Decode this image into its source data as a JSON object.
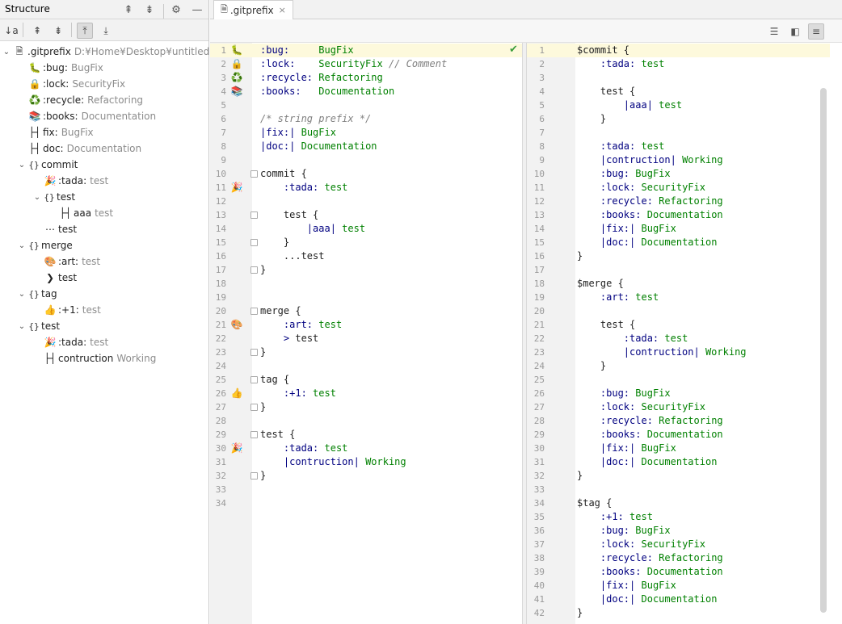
{
  "structure": {
    "title": "Structure",
    "root": {
      "name": ".gitprefix",
      "path": "D:¥Home¥Desktop¥untitled"
    },
    "nodes": [
      {
        "indent": 1,
        "icon": "🐛",
        "name": ":bug:",
        "value": "BugFix"
      },
      {
        "indent": 1,
        "icon": "🔒",
        "name": ":lock:",
        "value": "SecurityFix"
      },
      {
        "indent": 1,
        "icon": "♻️",
        "name": ":recycle:",
        "value": "Refactoring"
      },
      {
        "indent": 1,
        "icon": "📚",
        "name": ":books:",
        "value": "Documentation"
      },
      {
        "indent": 1,
        "icon": "├┤",
        "name": "fix:",
        "value": "BugFix"
      },
      {
        "indent": 1,
        "icon": "├┤",
        "name": "doc:",
        "value": "Documentation"
      },
      {
        "indent": 1,
        "icon": "{}",
        "name": "commit",
        "value": "",
        "arrow": "⌄"
      },
      {
        "indent": 2,
        "icon": "🎉",
        "name": ":tada:",
        "value": "test"
      },
      {
        "indent": 2,
        "icon": "{}",
        "name": "test",
        "value": "",
        "arrow": "⌄"
      },
      {
        "indent": 3,
        "icon": "├┤",
        "name": "aaa",
        "value": "test"
      },
      {
        "indent": 2,
        "icon": "⋯",
        "name": "test",
        "value": ""
      },
      {
        "indent": 1,
        "icon": "{}",
        "name": "merge",
        "value": "",
        "arrow": "⌄"
      },
      {
        "indent": 2,
        "icon": "🎨",
        "name": ":art:",
        "value": "test"
      },
      {
        "indent": 2,
        "icon": "❯",
        "name": "test",
        "value": ""
      },
      {
        "indent": 1,
        "icon": "{}",
        "name": "tag",
        "value": "",
        "arrow": "⌄"
      },
      {
        "indent": 2,
        "icon": "👍",
        "name": ":+1:",
        "value": "test"
      },
      {
        "indent": 1,
        "icon": "{}",
        "name": "test",
        "value": "",
        "arrow": "⌄"
      },
      {
        "indent": 2,
        "icon": "🎉",
        "name": ":tada:",
        "value": "test"
      },
      {
        "indent": 2,
        "icon": "├┤",
        "name": "contruction",
        "value": "Working"
      }
    ]
  },
  "editor": {
    "tab_label": ".gitprefix",
    "tab_close": "×"
  },
  "left_pane": {
    "lines": [
      {
        "n": "1",
        "icon": "🐛",
        "parts": [
          [
            "k",
            ":bug:     "
          ],
          [
            "s",
            "BugFix"
          ]
        ]
      },
      {
        "n": "2",
        "icon": "🔒",
        "parts": [
          [
            "k",
            ":lock:    "
          ],
          [
            "s",
            "SecurityFix"
          ],
          [
            "c",
            " // Comment"
          ]
        ]
      },
      {
        "n": "3",
        "icon": "♻️",
        "parts": [
          [
            "k",
            ":recycle: "
          ],
          [
            "s",
            "Refactoring"
          ]
        ]
      },
      {
        "n": "4",
        "icon": "📚",
        "parts": [
          [
            "k",
            ":books:   "
          ],
          [
            "s",
            "Documentation"
          ]
        ]
      },
      {
        "n": "5",
        "icon": "",
        "parts": []
      },
      {
        "n": "6",
        "icon": "",
        "parts": [
          [
            "c",
            "/* string prefix */"
          ]
        ]
      },
      {
        "n": "7",
        "icon": "",
        "parts": [
          [
            "k",
            "|fix:|"
          ],
          [
            "p",
            " "
          ],
          [
            "s",
            "BugFix"
          ]
        ]
      },
      {
        "n": "8",
        "icon": "",
        "parts": [
          [
            "k",
            "|doc:|"
          ],
          [
            "p",
            " "
          ],
          [
            "s",
            "Documentation"
          ]
        ]
      },
      {
        "n": "9",
        "icon": "",
        "parts": []
      },
      {
        "n": "10",
        "icon": "",
        "parts": [
          [
            "p",
            "commit {"
          ]
        ]
      },
      {
        "n": "11",
        "icon": "🎉",
        "parts": [
          [
            "p",
            "    "
          ],
          [
            "k",
            ":tada:"
          ],
          [
            "p",
            " "
          ],
          [
            "s",
            "test"
          ]
        ]
      },
      {
        "n": "12",
        "icon": "",
        "parts": []
      },
      {
        "n": "13",
        "icon": "",
        "parts": [
          [
            "p",
            "    test {"
          ]
        ]
      },
      {
        "n": "14",
        "icon": "",
        "parts": [
          [
            "p",
            "        "
          ],
          [
            "k",
            "|aaa|"
          ],
          [
            "p",
            " "
          ],
          [
            "s",
            "test"
          ]
        ]
      },
      {
        "n": "15",
        "icon": "",
        "parts": [
          [
            "p",
            "    }"
          ]
        ]
      },
      {
        "n": "16",
        "icon": "",
        "parts": [
          [
            "p",
            "    ...test"
          ]
        ]
      },
      {
        "n": "17",
        "icon": "",
        "parts": [
          [
            "p",
            "}"
          ]
        ]
      },
      {
        "n": "18",
        "icon": "",
        "parts": []
      },
      {
        "n": "19",
        "icon": "",
        "parts": []
      },
      {
        "n": "20",
        "icon": "",
        "parts": [
          [
            "p",
            "merge {"
          ]
        ]
      },
      {
        "n": "21",
        "icon": "🎨",
        "parts": [
          [
            "p",
            "    "
          ],
          [
            "k",
            ":art:"
          ],
          [
            "p",
            " "
          ],
          [
            "s",
            "test"
          ]
        ]
      },
      {
        "n": "22",
        "icon": "",
        "parts": [
          [
            "p",
            "    "
          ],
          [
            "k",
            ">"
          ],
          [
            "p",
            " test"
          ]
        ]
      },
      {
        "n": "23",
        "icon": "",
        "parts": [
          [
            "p",
            "}"
          ]
        ]
      },
      {
        "n": "24",
        "icon": "",
        "parts": []
      },
      {
        "n": "25",
        "icon": "",
        "parts": [
          [
            "p",
            "tag {"
          ]
        ]
      },
      {
        "n": "26",
        "icon": "👍",
        "parts": [
          [
            "p",
            "    "
          ],
          [
            "k",
            ":+1:"
          ],
          [
            "p",
            " "
          ],
          [
            "s",
            "test"
          ]
        ]
      },
      {
        "n": "27",
        "icon": "",
        "parts": [
          [
            "p",
            "}"
          ]
        ]
      },
      {
        "n": "28",
        "icon": "",
        "parts": []
      },
      {
        "n": "29",
        "icon": "",
        "parts": [
          [
            "p",
            "test {"
          ]
        ]
      },
      {
        "n": "30",
        "icon": "🎉",
        "parts": [
          [
            "p",
            "    "
          ],
          [
            "k",
            ":tada:"
          ],
          [
            "p",
            " "
          ],
          [
            "s",
            "test"
          ]
        ]
      },
      {
        "n": "31",
        "icon": "",
        "parts": [
          [
            "p",
            "    "
          ],
          [
            "k",
            "|contruction|"
          ],
          [
            "p",
            " "
          ],
          [
            "s",
            "Working"
          ]
        ]
      },
      {
        "n": "32",
        "icon": "",
        "parts": [
          [
            "p",
            "}"
          ]
        ]
      },
      {
        "n": "33",
        "icon": "",
        "parts": []
      },
      {
        "n": "34",
        "icon": "",
        "parts": []
      }
    ]
  },
  "right_pane": {
    "lines": [
      {
        "n": "1",
        "parts": [
          [
            "p",
            "$commit {"
          ]
        ]
      },
      {
        "n": "2",
        "parts": [
          [
            "p",
            "    "
          ],
          [
            "k",
            ":tada:"
          ],
          [
            "p",
            " "
          ],
          [
            "s",
            "test"
          ]
        ]
      },
      {
        "n": "3",
        "parts": []
      },
      {
        "n": "4",
        "parts": [
          [
            "p",
            "    test {"
          ]
        ]
      },
      {
        "n": "5",
        "parts": [
          [
            "p",
            "        "
          ],
          [
            "k",
            "|aaa|"
          ],
          [
            "p",
            " "
          ],
          [
            "s",
            "test"
          ]
        ]
      },
      {
        "n": "6",
        "parts": [
          [
            "p",
            "    }"
          ]
        ]
      },
      {
        "n": "7",
        "parts": []
      },
      {
        "n": "8",
        "parts": [
          [
            "p",
            "    "
          ],
          [
            "k",
            ":tada:"
          ],
          [
            "p",
            " "
          ],
          [
            "s",
            "test"
          ]
        ]
      },
      {
        "n": "9",
        "parts": [
          [
            "p",
            "    "
          ],
          [
            "k",
            "|contruction|"
          ],
          [
            "p",
            " "
          ],
          [
            "s",
            "Working"
          ]
        ]
      },
      {
        "n": "10",
        "parts": [
          [
            "p",
            "    "
          ],
          [
            "k",
            ":bug:"
          ],
          [
            "p",
            " "
          ],
          [
            "s",
            "BugFix"
          ]
        ]
      },
      {
        "n": "11",
        "parts": [
          [
            "p",
            "    "
          ],
          [
            "k",
            ":lock:"
          ],
          [
            "p",
            " "
          ],
          [
            "s",
            "SecurityFix"
          ]
        ]
      },
      {
        "n": "12",
        "parts": [
          [
            "p",
            "    "
          ],
          [
            "k",
            ":recycle:"
          ],
          [
            "p",
            " "
          ],
          [
            "s",
            "Refactoring"
          ]
        ]
      },
      {
        "n": "13",
        "parts": [
          [
            "p",
            "    "
          ],
          [
            "k",
            ":books:"
          ],
          [
            "p",
            " "
          ],
          [
            "s",
            "Documentation"
          ]
        ]
      },
      {
        "n": "14",
        "parts": [
          [
            "p",
            "    "
          ],
          [
            "k",
            "|fix:|"
          ],
          [
            "p",
            " "
          ],
          [
            "s",
            "BugFix"
          ]
        ]
      },
      {
        "n": "15",
        "parts": [
          [
            "p",
            "    "
          ],
          [
            "k",
            "|doc:|"
          ],
          [
            "p",
            " "
          ],
          [
            "s",
            "Documentation"
          ]
        ]
      },
      {
        "n": "16",
        "parts": [
          [
            "p",
            "}"
          ]
        ]
      },
      {
        "n": "17",
        "parts": []
      },
      {
        "n": "18",
        "parts": [
          [
            "p",
            "$merge {"
          ]
        ]
      },
      {
        "n": "19",
        "parts": [
          [
            "p",
            "    "
          ],
          [
            "k",
            ":art:"
          ],
          [
            "p",
            " "
          ],
          [
            "s",
            "test"
          ]
        ]
      },
      {
        "n": "20",
        "parts": []
      },
      {
        "n": "21",
        "parts": [
          [
            "p",
            "    test {"
          ]
        ]
      },
      {
        "n": "22",
        "parts": [
          [
            "p",
            "        "
          ],
          [
            "k",
            ":tada:"
          ],
          [
            "p",
            " "
          ],
          [
            "s",
            "test"
          ]
        ]
      },
      {
        "n": "23",
        "parts": [
          [
            "p",
            "        "
          ],
          [
            "k",
            "|contruction|"
          ],
          [
            "p",
            " "
          ],
          [
            "s",
            "Working"
          ]
        ]
      },
      {
        "n": "24",
        "parts": [
          [
            "p",
            "    }"
          ]
        ]
      },
      {
        "n": "25",
        "parts": []
      },
      {
        "n": "26",
        "parts": [
          [
            "p",
            "    "
          ],
          [
            "k",
            ":bug:"
          ],
          [
            "p",
            " "
          ],
          [
            "s",
            "BugFix"
          ]
        ]
      },
      {
        "n": "27",
        "parts": [
          [
            "p",
            "    "
          ],
          [
            "k",
            ":lock:"
          ],
          [
            "p",
            " "
          ],
          [
            "s",
            "SecurityFix"
          ]
        ]
      },
      {
        "n": "28",
        "parts": [
          [
            "p",
            "    "
          ],
          [
            "k",
            ":recycle:"
          ],
          [
            "p",
            " "
          ],
          [
            "s",
            "Refactoring"
          ]
        ]
      },
      {
        "n": "29",
        "parts": [
          [
            "p",
            "    "
          ],
          [
            "k",
            ":books:"
          ],
          [
            "p",
            " "
          ],
          [
            "s",
            "Documentation"
          ]
        ]
      },
      {
        "n": "30",
        "parts": [
          [
            "p",
            "    "
          ],
          [
            "k",
            "|fix:|"
          ],
          [
            "p",
            " "
          ],
          [
            "s",
            "BugFix"
          ]
        ]
      },
      {
        "n": "31",
        "parts": [
          [
            "p",
            "    "
          ],
          [
            "k",
            "|doc:|"
          ],
          [
            "p",
            " "
          ],
          [
            "s",
            "Documentation"
          ]
        ]
      },
      {
        "n": "32",
        "parts": [
          [
            "p",
            "}"
          ]
        ]
      },
      {
        "n": "33",
        "parts": []
      },
      {
        "n": "34",
        "parts": [
          [
            "p",
            "$tag {"
          ]
        ]
      },
      {
        "n": "35",
        "parts": [
          [
            "p",
            "    "
          ],
          [
            "k",
            ":+1:"
          ],
          [
            "p",
            " "
          ],
          [
            "s",
            "test"
          ]
        ]
      },
      {
        "n": "36",
        "parts": [
          [
            "p",
            "    "
          ],
          [
            "k",
            ":bug:"
          ],
          [
            "p",
            " "
          ],
          [
            "s",
            "BugFix"
          ]
        ]
      },
      {
        "n": "37",
        "parts": [
          [
            "p",
            "    "
          ],
          [
            "k",
            ":lock:"
          ],
          [
            "p",
            " "
          ],
          [
            "s",
            "SecurityFix"
          ]
        ]
      },
      {
        "n": "38",
        "parts": [
          [
            "p",
            "    "
          ],
          [
            "k",
            ":recycle:"
          ],
          [
            "p",
            " "
          ],
          [
            "s",
            "Refactoring"
          ]
        ]
      },
      {
        "n": "39",
        "parts": [
          [
            "p",
            "    "
          ],
          [
            "k",
            ":books:"
          ],
          [
            "p",
            " "
          ],
          [
            "s",
            "Documentation"
          ]
        ]
      },
      {
        "n": "40",
        "parts": [
          [
            "p",
            "    "
          ],
          [
            "k",
            "|fix:|"
          ],
          [
            "p",
            " "
          ],
          [
            "s",
            "BugFix"
          ]
        ]
      },
      {
        "n": "41",
        "parts": [
          [
            "p",
            "    "
          ],
          [
            "k",
            "|doc:|"
          ],
          [
            "p",
            " "
          ],
          [
            "s",
            "Documentation"
          ]
        ]
      },
      {
        "n": "42",
        "parts": [
          [
            "p",
            "}"
          ]
        ]
      }
    ]
  },
  "colors": {
    "keyword": "#000080",
    "string": "#008000",
    "comment": "#808080",
    "current_line": "#fdf9dc"
  }
}
